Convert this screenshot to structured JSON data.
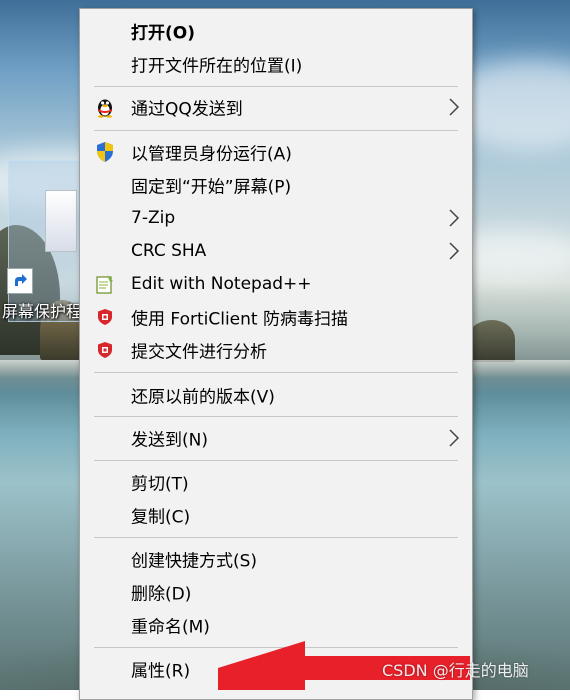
{
  "desktop": {
    "shortcut_label": "屏幕保护程"
  },
  "context_menu": {
    "items": [
      {
        "label": "打开(O)",
        "bold": true,
        "icon": null,
        "submenu": false
      },
      {
        "label": "打开文件所在的位置(I)",
        "icon": null,
        "submenu": false
      },
      {
        "label": "通过QQ发送到",
        "icon": "qq-penguin-icon",
        "submenu": true
      },
      {
        "label": "以管理员身份运行(A)",
        "icon": "uac-shield-icon",
        "submenu": false
      },
      {
        "label": "固定到“开始”屏幕(P)",
        "icon": null,
        "submenu": false
      },
      {
        "label": "7-Zip",
        "icon": null,
        "submenu": true
      },
      {
        "label": "CRC SHA",
        "icon": null,
        "submenu": true
      },
      {
        "label": "Edit with Notepad++",
        "icon": "notepad-plus-plus-icon",
        "submenu": false
      },
      {
        "label": "使用 FortiClient 防病毒扫描",
        "icon": "forticlient-icon",
        "submenu": false
      },
      {
        "label": "提交文件进行分析",
        "icon": "forticlient-icon",
        "submenu": false
      },
      {
        "label": "还原以前的版本(V)",
        "icon": null,
        "submenu": false
      },
      {
        "label": "发送到(N)",
        "icon": null,
        "submenu": true
      },
      {
        "label": "剪切(T)",
        "icon": null,
        "submenu": false
      },
      {
        "label": "复制(C)",
        "icon": null,
        "submenu": false
      },
      {
        "label": "创建快捷方式(S)",
        "icon": null,
        "submenu": false
      },
      {
        "label": "删除(D)",
        "icon": null,
        "submenu": false
      },
      {
        "label": "重命名(M)",
        "icon": null,
        "submenu": false
      },
      {
        "label": "属性(R)",
        "icon": null,
        "submenu": false
      }
    ]
  },
  "annotation": {
    "arrow_color": "#e8202a",
    "points_to": "属性(R)"
  },
  "watermark": "CSDN @行走的电脑"
}
